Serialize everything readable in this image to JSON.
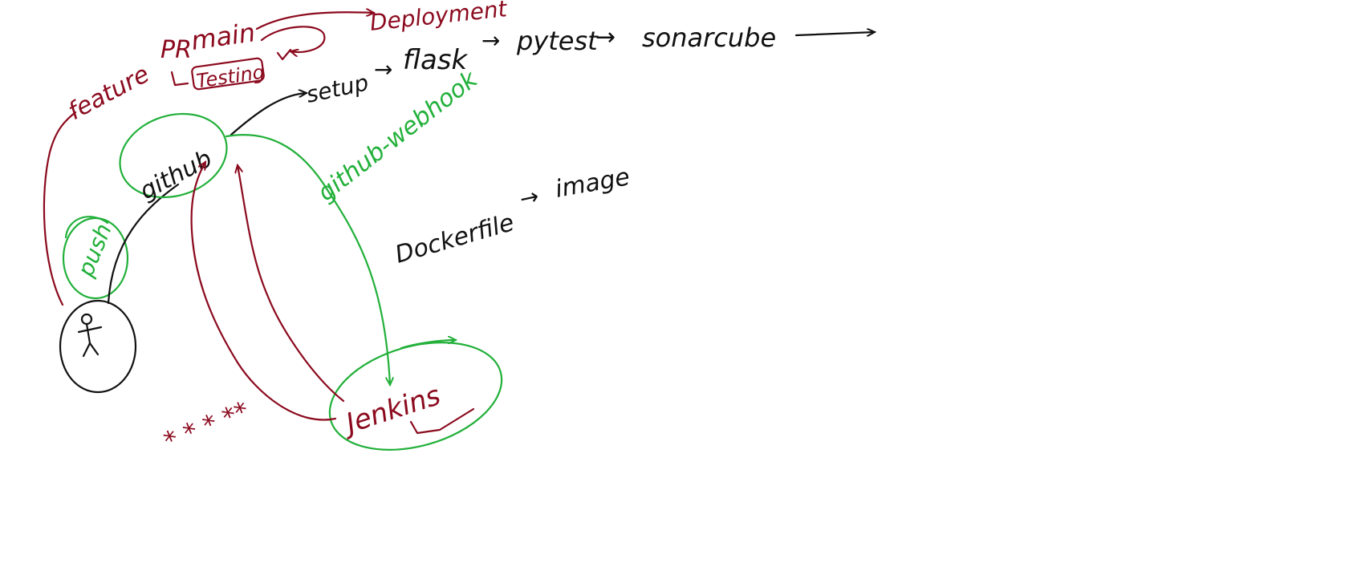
{
  "colors": {
    "ink_black": "#111111",
    "ink_dark_red": "#8b0a1e",
    "ink_green": "#22b03a",
    "background": "#ffffff"
  },
  "labels": {
    "feature": "feature",
    "pr": "PR",
    "main": "main",
    "deployment": "Deployment",
    "testing": "Testing",
    "setup": "setup",
    "flask": "flask",
    "pytest": "pytest",
    "sonarcube": "sonarcube",
    "github": "github",
    "github_webhook": "github-webhook",
    "dockerfile": "Dockerfile",
    "image": "image",
    "push": "push",
    "jenkins": "Jenkins",
    "stars": "* * * **"
  },
  "arrows": {
    "right": "→"
  },
  "icons": {
    "developer": "stick-figure-icon"
  }
}
